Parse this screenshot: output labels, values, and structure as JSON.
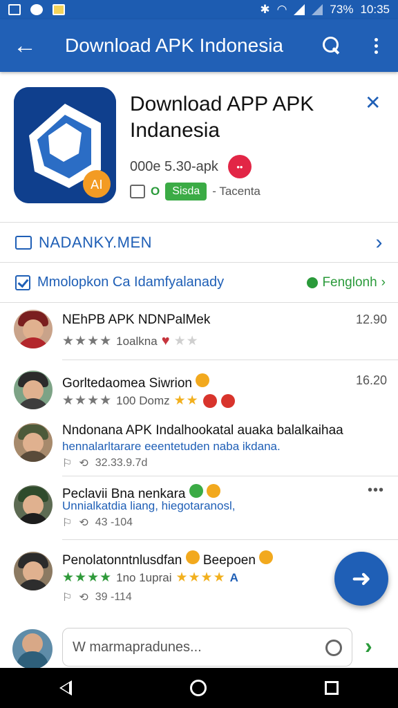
{
  "status_bar": {
    "battery": "73%",
    "time": "10:35"
  },
  "app_bar": {
    "title": "Download APK Indonesia"
  },
  "app_header": {
    "name_line1": "Download APP APK",
    "name_line2": "Indanesia",
    "meta": "000e 5.30-apk",
    "badge_text": "••",
    "label_green": "O",
    "pill": "Sisda",
    "label_tail": "- Tacenta"
  },
  "row1": {
    "label": "NADANKY.MEN"
  },
  "row2": {
    "label": "Mmolopkon Ca  Idamfyalanady",
    "action": "Fenglonh"
  },
  "reviews": [
    {
      "name": "NEhPB APK NDNPalMek",
      "time": "12.90",
      "stars": "★★★★",
      "line": "1oalkna",
      "stars_extra": "★★"
    },
    {
      "name": "Gorltedaomea Siwrion",
      "time": "16.20",
      "stars": "★★★★",
      "line": "100 Domz",
      "stars_extra": "★★"
    },
    {
      "name": "Nndonana APK Indalhookatal auaka balalkaihaa",
      "text": "hennalarltarare eeentetuden naba ikdana.",
      "meta_a": "32.33.9.7d"
    },
    {
      "name": "Peclavii Bna nenkara",
      "text": "Unnialkatdia liang, hiegotaranosl,",
      "meta_a": "43 -104"
    },
    {
      "name": "Penolatonntnlusdfan",
      "name_tail": "Beepoen",
      "stars": "★★★★",
      "line": "1no 1uprai",
      "stars_extra": "★★★★",
      "meta_a": "39 -114"
    }
  ],
  "compose": {
    "placeholder": "W marmapradunes..."
  },
  "colors": {
    "primary": "#2160b6",
    "accent_green": "#3bab45",
    "badge_red": "#e22646"
  }
}
